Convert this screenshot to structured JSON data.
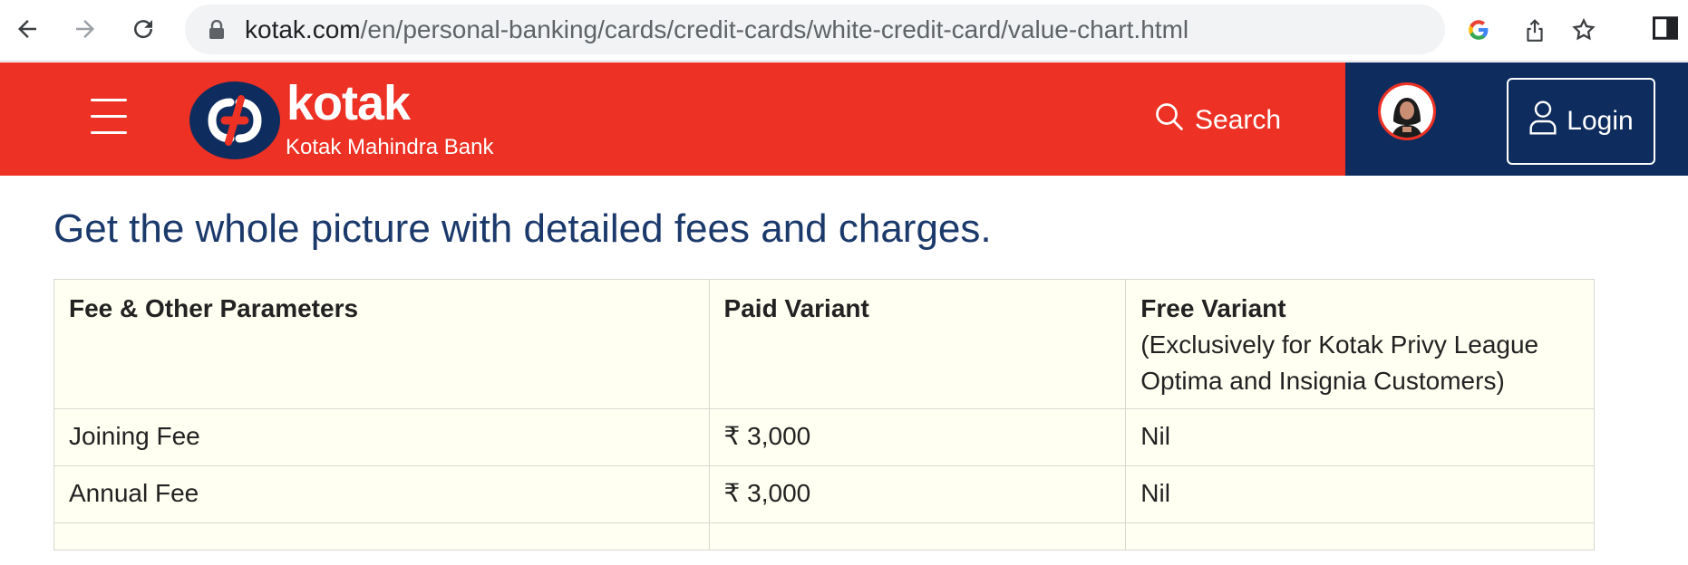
{
  "browser": {
    "url_host": "kotak.com",
    "url_path": "/en/personal-banking/cards/credit-cards/white-credit-card/value-chart.html",
    "icons": [
      "back-icon",
      "forward-icon",
      "reload-icon",
      "lock-icon",
      "google-icon",
      "share-icon",
      "star-icon",
      "sidebar-icon"
    ]
  },
  "header": {
    "logo_word": "kotak",
    "logo_sub": "Kotak Mahindra Bank",
    "search_label": "Search",
    "login_label": "Login",
    "colors": {
      "brand_red": "#ed3124",
      "brand_navy": "#0e2d5e"
    }
  },
  "main": {
    "heading": "Get the whole picture with detailed fees and charges.",
    "table": {
      "headers": [
        {
          "title": "Fee & Other Parameters",
          "note": ""
        },
        {
          "title": "Paid Variant",
          "note": ""
        },
        {
          "title": "Free Variant",
          "note": "(Exclusively for Kotak Privy League Optima and Insignia Customers)"
        }
      ],
      "rows": [
        [
          "Joining Fee",
          "₹ 3,000",
          "Nil"
        ],
        [
          "Annual Fee",
          "₹ 3,000",
          "Nil"
        ]
      ]
    }
  }
}
